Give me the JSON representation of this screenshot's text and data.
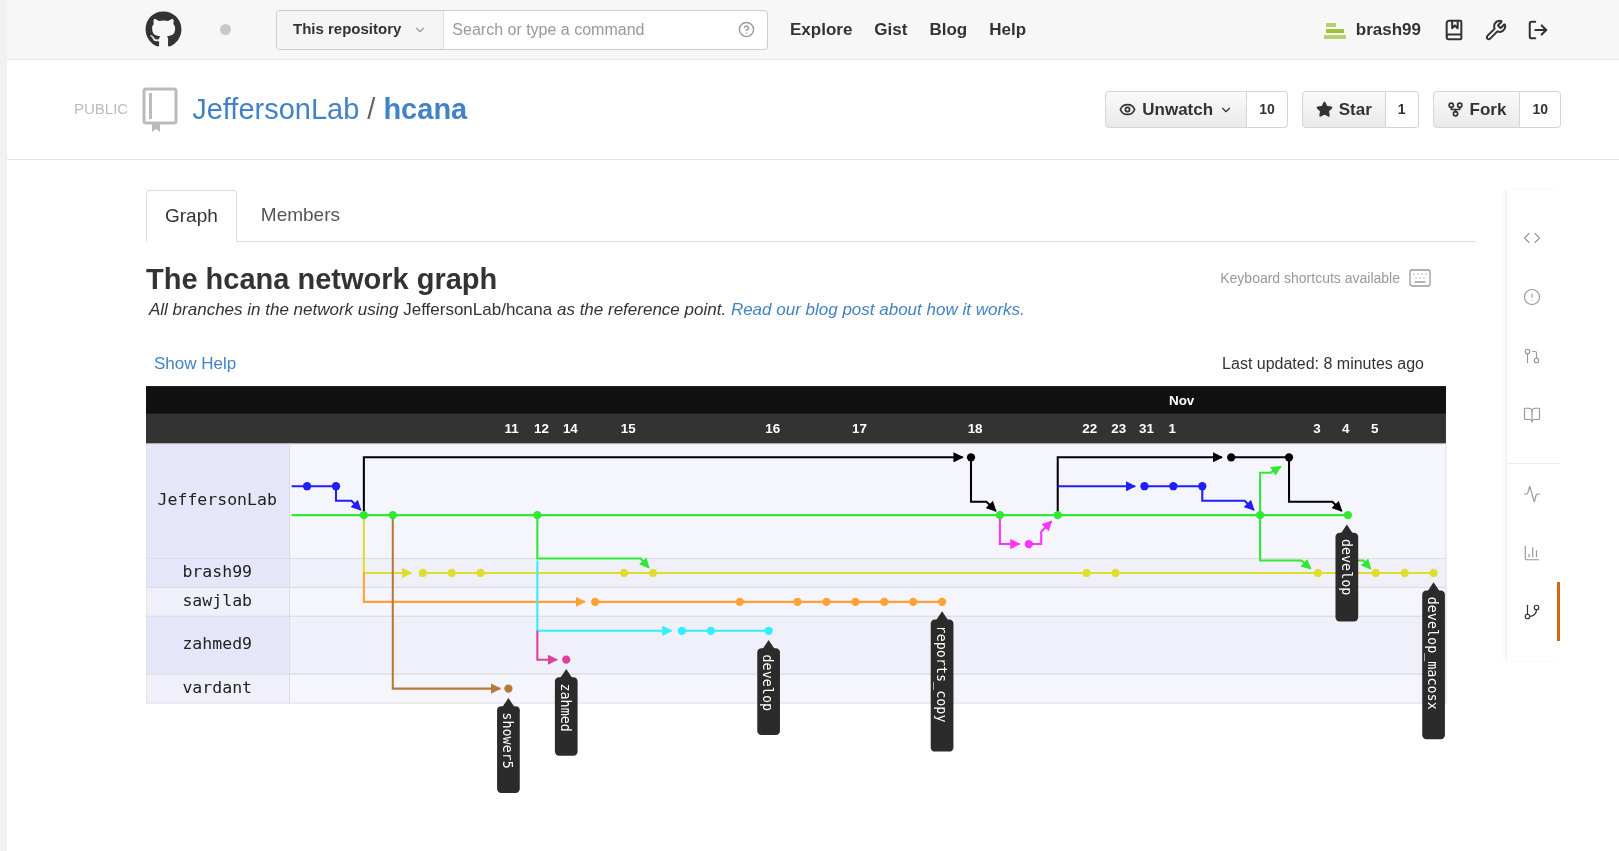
{
  "topbar": {
    "scope": "This repository",
    "search": {
      "placeholder": "Search or type a command"
    },
    "nav": [
      "Explore",
      "Gist",
      "Blog",
      "Help"
    ],
    "user": "brash99"
  },
  "repo": {
    "visibility": "PUBLIC",
    "owner": "JeffersonLab",
    "separator": "/",
    "name": "hcana",
    "actions": [
      {
        "kind": "watch",
        "label": "Unwatch",
        "count": "10"
      },
      {
        "kind": "star",
        "label": "Star",
        "count": "1"
      },
      {
        "kind": "fork",
        "label": "Fork",
        "count": "10"
      }
    ]
  },
  "tabs": [
    {
      "label": "Graph",
      "selected": true
    },
    {
      "label": "Members",
      "selected": false
    }
  ],
  "heading": "The hcana network graph",
  "description": "*All branches in the network using* JeffersonLab/hcana *as the reference point.*",
  "description_link": "Read our blog post about how it works.",
  "shortcuts": "Keyboard shortcuts available",
  "show_help": "Show Help",
  "last_updated": "Last updated: 8 minutes ago",
  "graph": {
    "month": "Nov",
    "days": [
      "11",
      "12",
      "14",
      "15",
      "16",
      "17",
      "18",
      "22",
      "23",
      "31",
      "1",
      "3",
      "4",
      "5"
    ],
    "users": [
      "JeffersonLab",
      "brash99",
      "sawjlab",
      "zahmed9",
      "vardant"
    ],
    "branch_tags": [
      "shower5",
      "zahmed",
      "develop",
      "reports_copy",
      "develop",
      "develop_macosx"
    ]
  },
  "sidebar": {
    "items": [
      {
        "kind": "code",
        "selected": false
      },
      {
        "kind": "issues",
        "selected": false
      },
      {
        "kind": "pulls",
        "selected": false
      },
      {
        "kind": "wiki",
        "selected": false
      },
      {
        "kind": "pulse",
        "selected": false
      },
      {
        "kind": "graphs",
        "selected": false
      },
      {
        "kind": "network",
        "selected": true
      }
    ]
  }
}
